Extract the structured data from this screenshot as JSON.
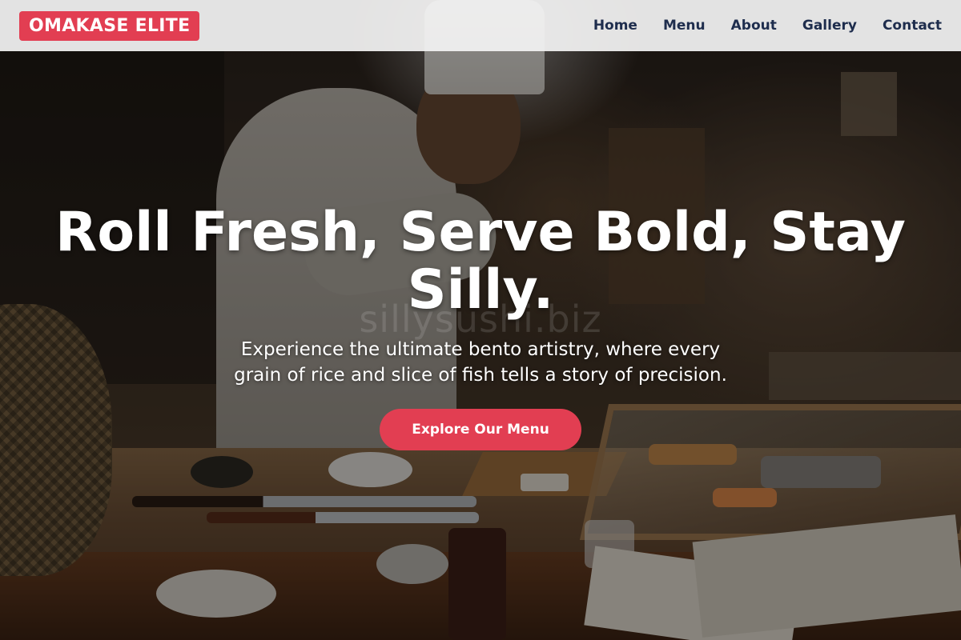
{
  "header": {
    "brand": "OMAKASE ELITE",
    "nav": [
      {
        "label": "Home"
      },
      {
        "label": "Menu"
      },
      {
        "label": "About"
      },
      {
        "label": "Gallery"
      },
      {
        "label": "Contact"
      }
    ]
  },
  "hero": {
    "title": "Roll Fresh, Serve Bold, Stay Silly.",
    "subtitle": "Experience the ultimate bento artistry, where every grain of rice and slice of fish tells a story of precision.",
    "cta_label": "Explore Our Menu",
    "watermark": "sillysushi.biz",
    "background_description_icon": "chef-preparing-sushi-photo"
  },
  "colors": {
    "accent": "#e23e52",
    "nav_text": "#1e2d4d",
    "nav_background": "#f3f3f3"
  }
}
